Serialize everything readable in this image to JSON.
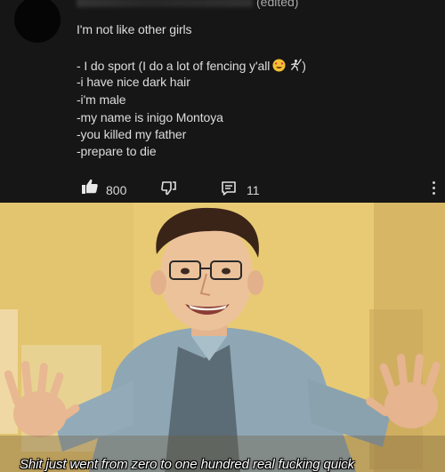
{
  "comment": {
    "edited_label": "(edited)",
    "lines": [
      "I'm not like other girls",
      "- I do sport (I do a lot of fencing y'all",
      "-i have nice dark hair",
      "-i'm male",
      "-my name is inigo Montoya",
      "-you killed my father",
      "-prepare to die"
    ],
    "emoji_trailer": ")",
    "emojis": [
      "heart-eyes-emoji",
      "fencing-emoji"
    ]
  },
  "actions": {
    "like_count": "800",
    "reply_count": "11",
    "icons": [
      "thumbs-up-icon",
      "thumbs-down-icon",
      "reply-icon",
      "more-vertical-icon"
    ]
  },
  "meme": {
    "caption": "Shit just went from zero to one hundred real fucking quick",
    "colors": {
      "background": "#e7c86f",
      "shirt": "#8fa7b4",
      "caption_text": "#ffffff"
    }
  }
}
